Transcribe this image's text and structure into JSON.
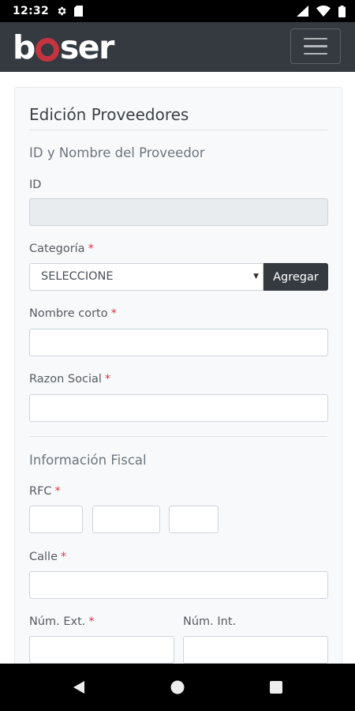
{
  "status_bar": {
    "time": "12:32",
    "left_icons": [
      "settings-gear-icon",
      "sd-card-icon"
    ],
    "right_icons": [
      "signal-icon",
      "wifi-icon",
      "battery-icon"
    ]
  },
  "navbar": {
    "logo_part1": "b",
    "logo_part2": "ser",
    "menu_icon": "hamburger-menu-icon",
    "accent_color": "#c43440",
    "bg_color": "#343a40"
  },
  "form": {
    "title": "Edición Proveedores",
    "section_1": "ID y Nombre del Proveedor",
    "id_label": "ID",
    "id_value": "",
    "categoria_label": "Categoría",
    "required_mark": "*",
    "categoria_selected": "SELECCIONE",
    "agregar_label": "Agregar",
    "nombre_corto_label": "Nombre corto",
    "nombre_corto_value": "",
    "razon_social_label": "Razon Social",
    "razon_social_value": "",
    "section_2": "Información Fiscal",
    "rfc_label": "RFC",
    "rfc_values": [
      "",
      "",
      ""
    ],
    "calle_label": "Calle",
    "calle_value": "",
    "num_ext_label": "Núm. Ext.",
    "num_ext_value": "",
    "num_int_label": "Núm. Int.",
    "num_int_value": ""
  },
  "nav_bar": {
    "buttons": [
      "back-icon",
      "home-icon",
      "recents-icon"
    ]
  }
}
